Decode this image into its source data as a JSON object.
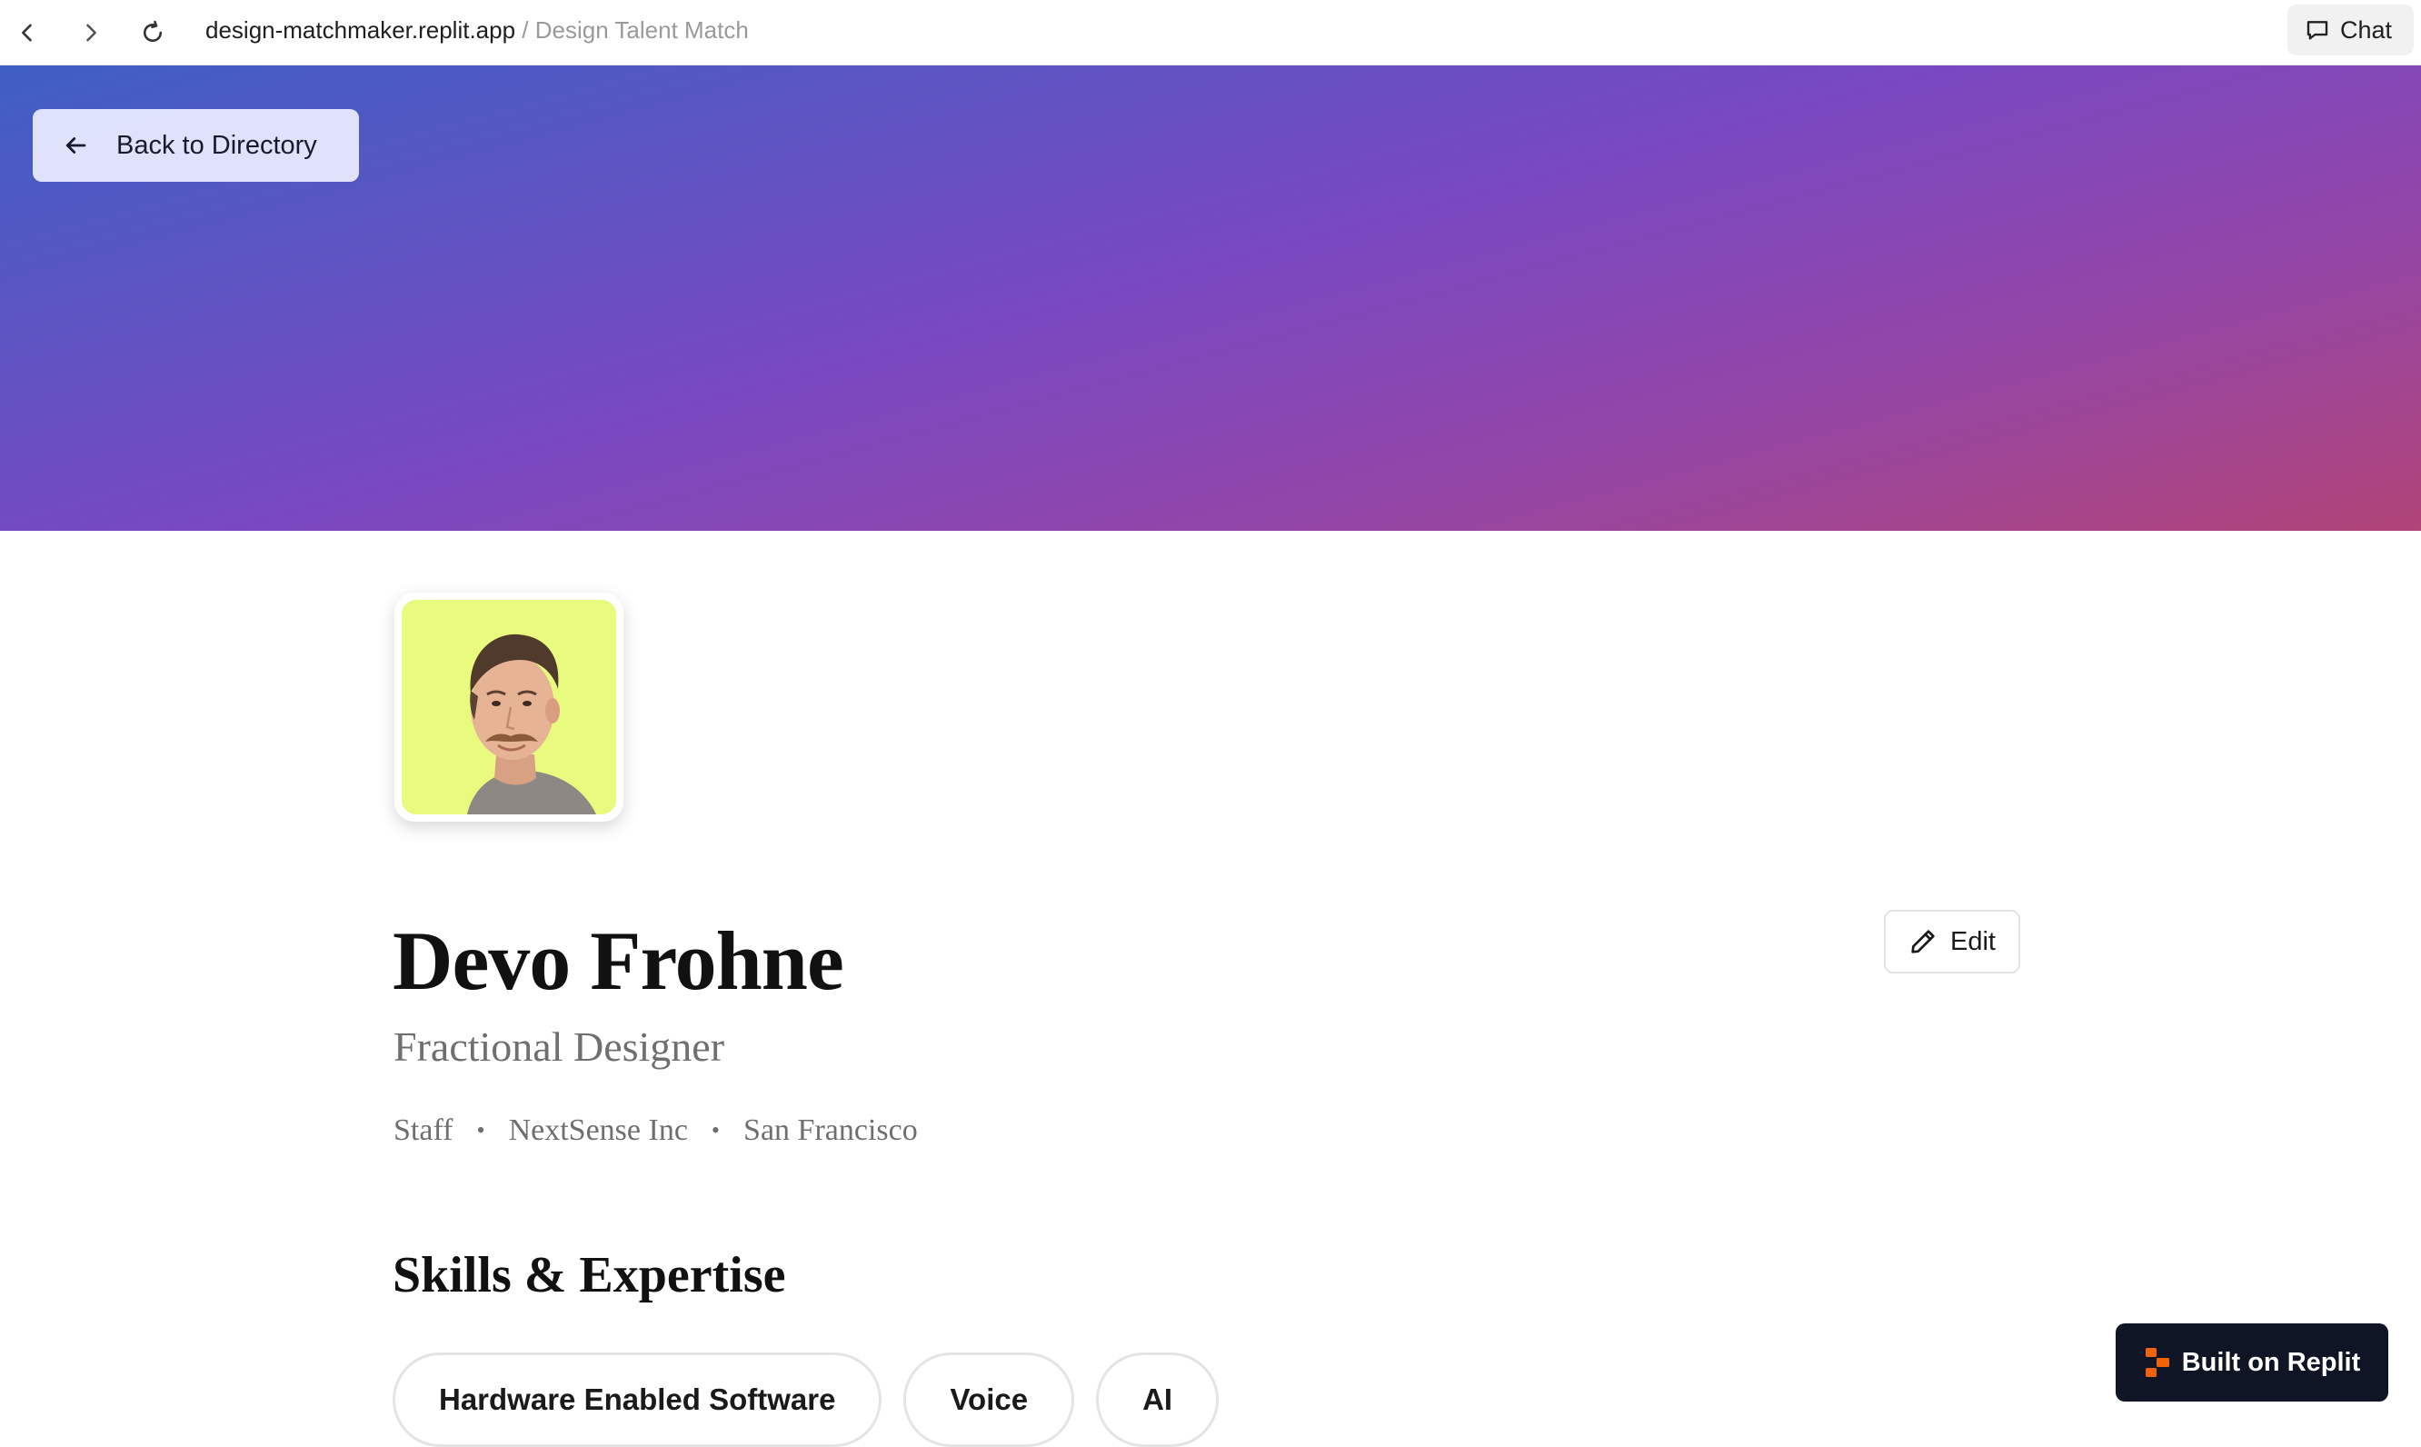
{
  "browser": {
    "url_host": "design-matchmaker.replit.app",
    "url_separator": " / ",
    "page_title": "Design Talent Match",
    "chat_label": "Chat"
  },
  "banner": {
    "back_label": "Back to Directory",
    "gradient_colors": [
      "#3f5fc4",
      "#7a48c0",
      "#b14478"
    ]
  },
  "profile": {
    "name": "Devo Frohne",
    "role": "Fractional Designer",
    "meta": [
      "Staff",
      "NextSense Inc",
      "San Francisco"
    ],
    "meta_separator": "•",
    "edit_label": "Edit",
    "avatar_bg": "#e8fb7f"
  },
  "skills": {
    "title": "Skills & Expertise",
    "items": [
      "Hardware Enabled Software",
      "Voice",
      "AI"
    ]
  },
  "badge": {
    "label": "Built on Replit",
    "brand_color": "#f26207"
  }
}
